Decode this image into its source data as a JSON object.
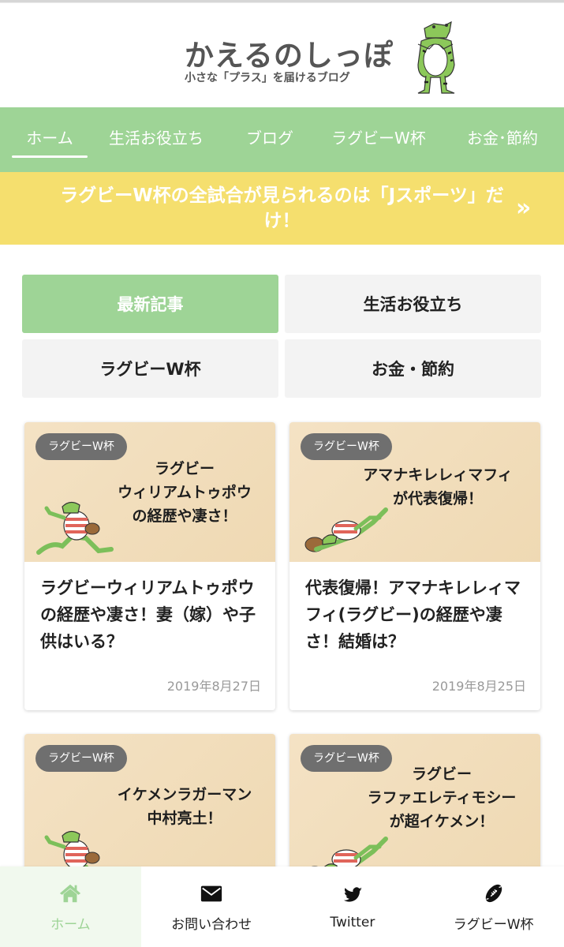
{
  "header": {
    "title": "かえるのしっぽ",
    "tagline": "小さな「プラス」を届けるブログ",
    "logo_icon": "frog-mascot-icon"
  },
  "nav": {
    "items": [
      {
        "label": "ホーム",
        "active": true
      },
      {
        "label": "生活お役立ち",
        "active": false
      },
      {
        "label": "ブログ",
        "active": false
      },
      {
        "label": "ラグビーW杯",
        "active": false
      },
      {
        "label": "お金･節約",
        "active": false
      }
    ]
  },
  "notice": {
    "text": "ラグビーW杯の全試合が見られるのは「Jスポーツ」だけ！",
    "arrow": "»"
  },
  "tabs": [
    {
      "label": "最新記事",
      "active": true
    },
    {
      "label": "生活お役立ち",
      "active": false
    },
    {
      "label": "ラグビーW杯",
      "active": false
    },
    {
      "label": "お金・節約",
      "active": false
    }
  ],
  "cards": [
    {
      "category": "ラグビーW杯",
      "thumb_text": "ラグビー\nウィリアムトゥポウ\nの経歴や凄さ！",
      "title": "ラグビーウィリアムトゥポウの経歴や凄さ！妻（嫁）や子供はいる？",
      "date": "2019年8月27日"
    },
    {
      "category": "ラグビーW杯",
      "thumb_text": "アマナキレレィマフィ\nが代表復帰！",
      "title": "代表復帰！アマナキレレィマフィ(ラグビー)の経歴や凄さ！結婚は？",
      "date": "2019年8月25日"
    },
    {
      "category": "ラグビーW杯",
      "thumb_text": "イケメンラガーマン\n中村亮土！",
      "title": "",
      "date": ""
    },
    {
      "category": "ラグビーW杯",
      "thumb_text": "ラグビー\nラファエレティモシー\nが超イケメン！",
      "title": "",
      "date": ""
    }
  ],
  "bottom_menu": [
    {
      "label": "ホーム",
      "icon": "home-icon",
      "active": true
    },
    {
      "label": "お問い合わせ",
      "icon": "envelope-icon",
      "active": false
    },
    {
      "label": "Twitter",
      "icon": "twitter-icon",
      "active": false
    },
    {
      "label": "ラグビーW杯",
      "icon": "rugby-ball-icon",
      "active": false
    }
  ],
  "colors": {
    "primary_green": "#9ed496",
    "notice_yellow": "#f5df6e",
    "badge_gray": "#6f6f6f",
    "active_bg": "#f1f9ee"
  }
}
